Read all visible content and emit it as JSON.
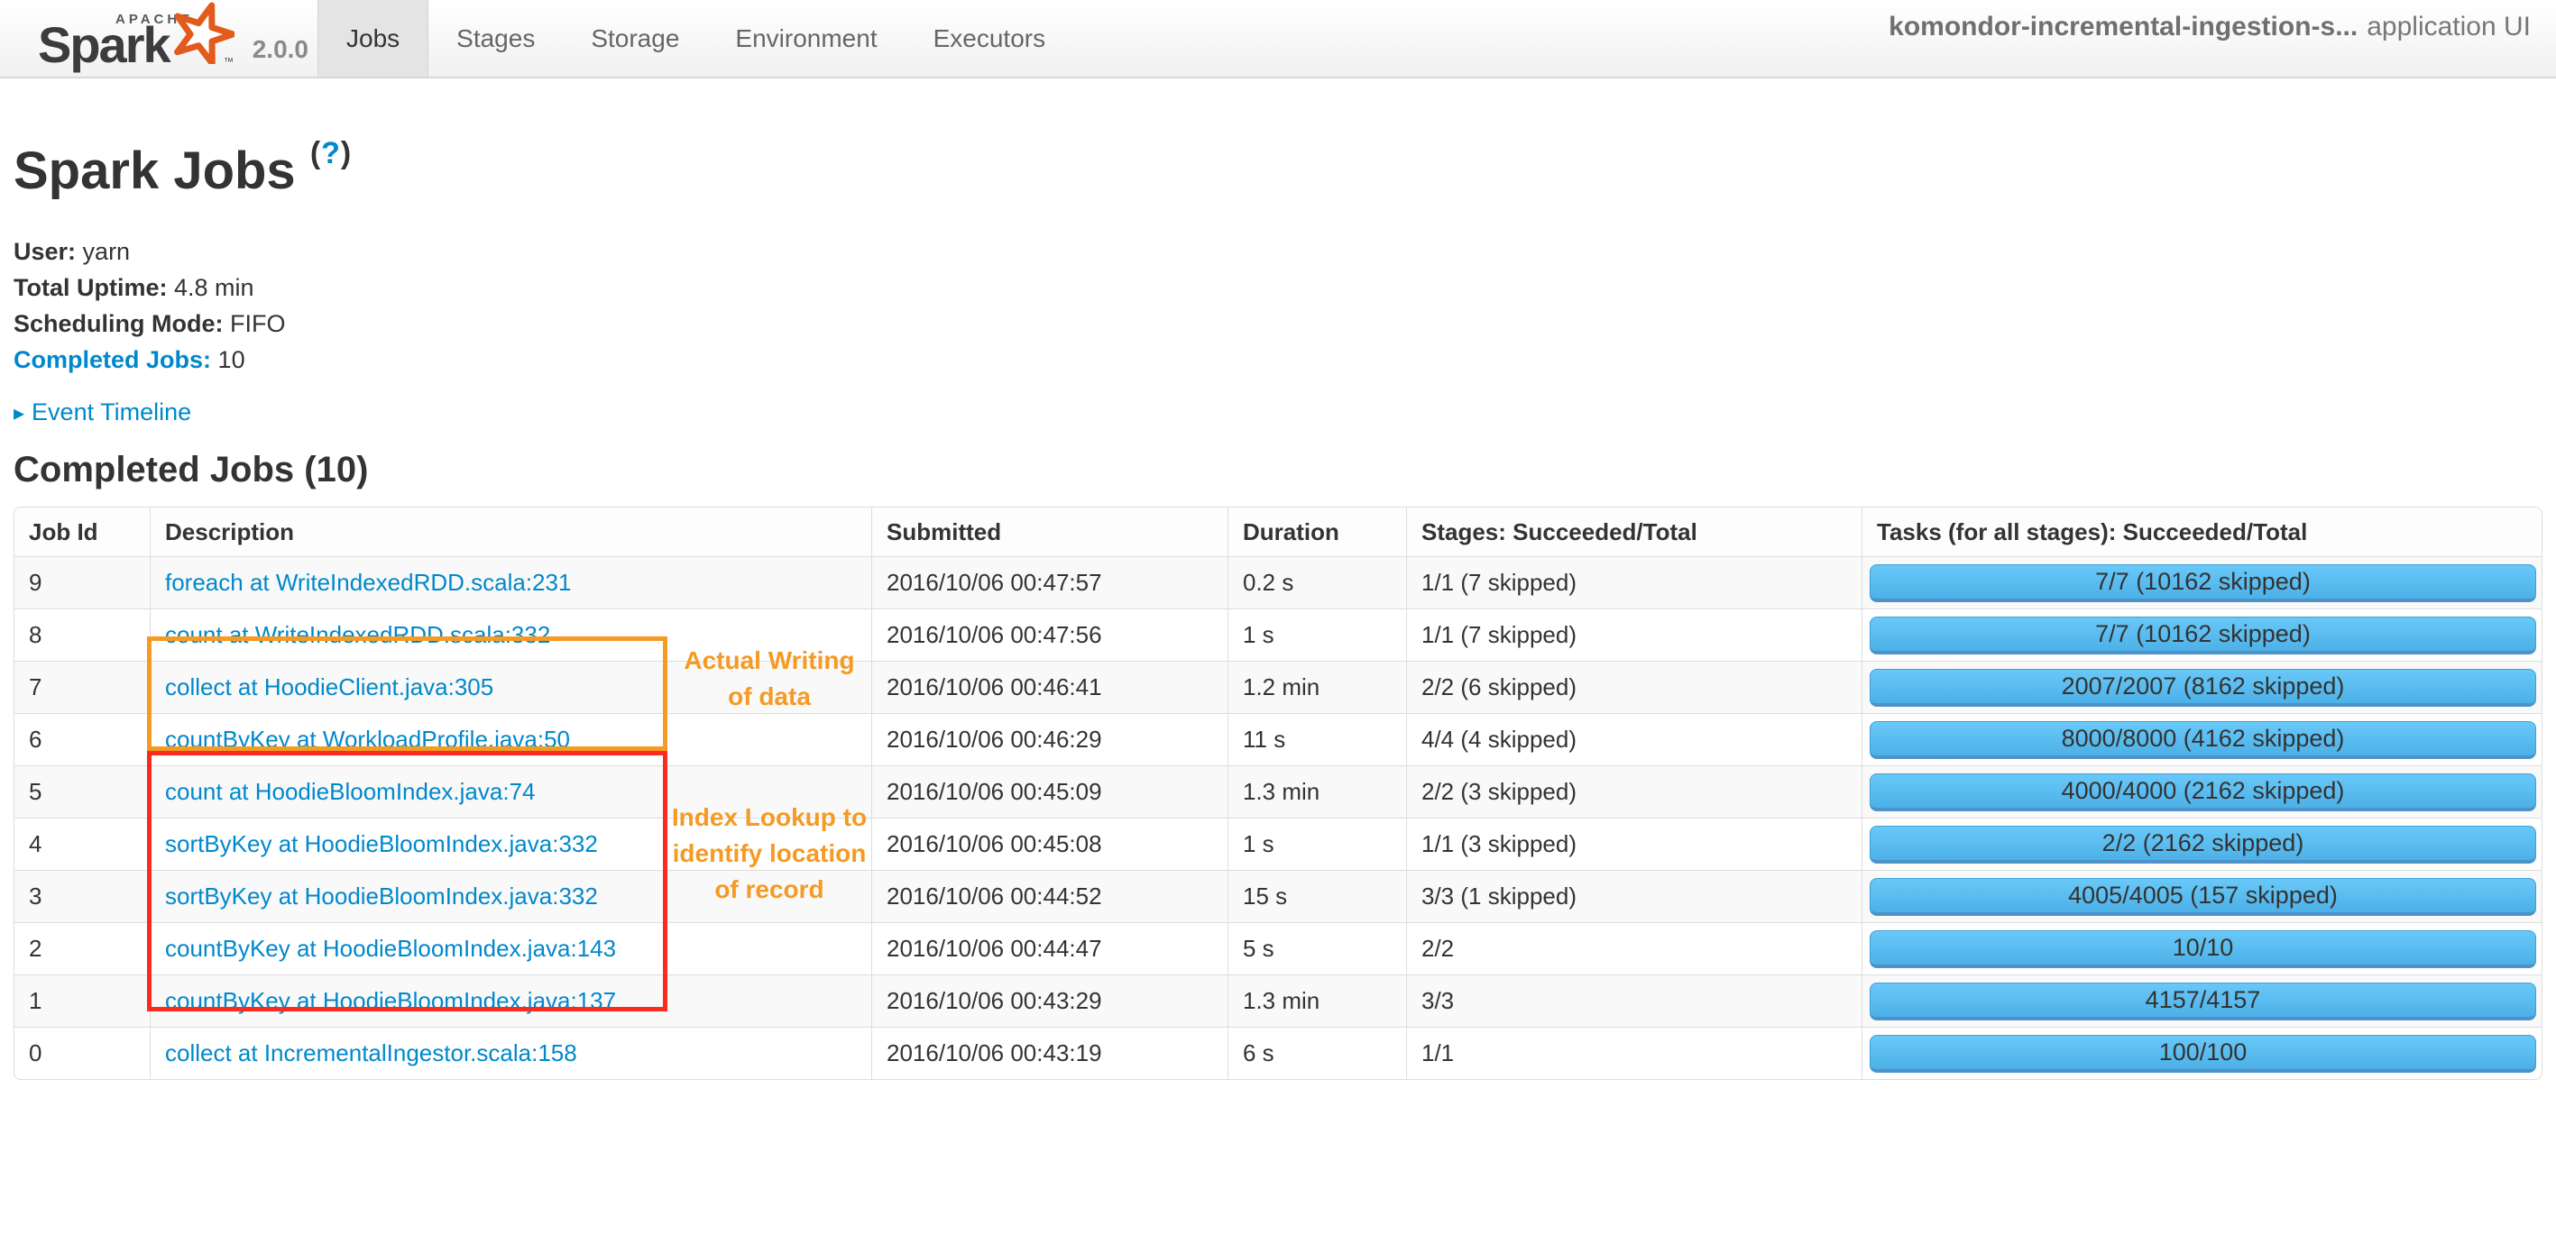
{
  "navbar": {
    "logo": {
      "apache": "APACHE",
      "name": "Spark",
      "tm": "™",
      "version": "2.0.0"
    },
    "tabs": [
      {
        "label": "Jobs",
        "active": true
      },
      {
        "label": "Stages",
        "active": false
      },
      {
        "label": "Storage",
        "active": false
      },
      {
        "label": "Environment",
        "active": false
      },
      {
        "label": "Executors",
        "active": false
      }
    ],
    "app_name": "komondor-incremental-ingestion-s...",
    "app_suffix": "application UI"
  },
  "header": {
    "title": "Spark Jobs",
    "help_open": "(",
    "help_q": "?",
    "help_close": ")"
  },
  "summary": {
    "user_label": "User:",
    "user_value": "yarn",
    "uptime_label": "Total Uptime:",
    "uptime_value": "4.8 min",
    "scheduling_label": "Scheduling Mode:",
    "scheduling_value": "FIFO",
    "completed_label": "Completed Jobs:",
    "completed_value": "10"
  },
  "event_timeline": {
    "icon": "▸",
    "label": "Event Timeline"
  },
  "section_title": "Completed Jobs (10)",
  "table": {
    "headers": [
      "Job Id",
      "Description",
      "Submitted",
      "Duration",
      "Stages: Succeeded/Total",
      "Tasks (for all stages): Succeeded/Total"
    ],
    "rows": [
      {
        "job_id": "9",
        "description": "foreach at WriteIndexedRDD.scala:231",
        "submitted": "2016/10/06 00:47:57",
        "duration": "0.2 s",
        "stages": "1/1 (7 skipped)",
        "tasks": "7/7 (10162 skipped)"
      },
      {
        "job_id": "8",
        "description": "count at WriteIndexedRDD.scala:332",
        "submitted": "2016/10/06 00:47:56",
        "duration": "1 s",
        "stages": "1/1 (7 skipped)",
        "tasks": "7/7 (10162 skipped)"
      },
      {
        "job_id": "7",
        "description": "collect at HoodieClient.java:305",
        "submitted": "2016/10/06 00:46:41",
        "duration": "1.2 min",
        "stages": "2/2 (6 skipped)",
        "tasks": "2007/2007 (8162 skipped)"
      },
      {
        "job_id": "6",
        "description": "countByKey at WorkloadProfile.java:50",
        "submitted": "2016/10/06 00:46:29",
        "duration": "11 s",
        "stages": "4/4 (4 skipped)",
        "tasks": "8000/8000 (4162 skipped)"
      },
      {
        "job_id": "5",
        "description": "count at HoodieBloomIndex.java:74",
        "submitted": "2016/10/06 00:45:09",
        "duration": "1.3 min",
        "stages": "2/2 (3 skipped)",
        "tasks": "4000/4000 (2162 skipped)"
      },
      {
        "job_id": "4",
        "description": "sortByKey at HoodieBloomIndex.java:332",
        "submitted": "2016/10/06 00:45:08",
        "duration": "1 s",
        "stages": "1/1 (3 skipped)",
        "tasks": "2/2 (2162 skipped)"
      },
      {
        "job_id": "3",
        "description": "sortByKey at HoodieBloomIndex.java:332",
        "submitted": "2016/10/06 00:44:52",
        "duration": "15 s",
        "stages": "3/3 (1 skipped)",
        "tasks": "4005/4005 (157 skipped)"
      },
      {
        "job_id": "2",
        "description": "countByKey at HoodieBloomIndex.java:143",
        "submitted": "2016/10/06 00:44:47",
        "duration": "5 s",
        "stages": "2/2",
        "tasks": "10/10"
      },
      {
        "job_id": "1",
        "description": "countByKey at HoodieBloomIndex.java:137",
        "submitted": "2016/10/06 00:43:29",
        "duration": "1.3 min",
        "stages": "3/3",
        "tasks": "4157/4157"
      },
      {
        "job_id": "0",
        "description": "collect at IncrementalIngestor.scala:158",
        "submitted": "2016/10/06 00:43:19",
        "duration": "6 s",
        "stages": "1/1",
        "tasks": "100/100"
      }
    ]
  },
  "annotations": {
    "writing_label": "Actual Writing of data",
    "index_label": "Index Lookup to identify location of record"
  },
  "colors": {
    "link_blue": "#0088cc",
    "progress_bar_top": "#69c8f8",
    "progress_bar_bottom": "#4cb1e8",
    "annotation_orange": "#f59a23",
    "annotation_red": "#f92c1d",
    "spark_logo_orange": "#e25a1c"
  }
}
